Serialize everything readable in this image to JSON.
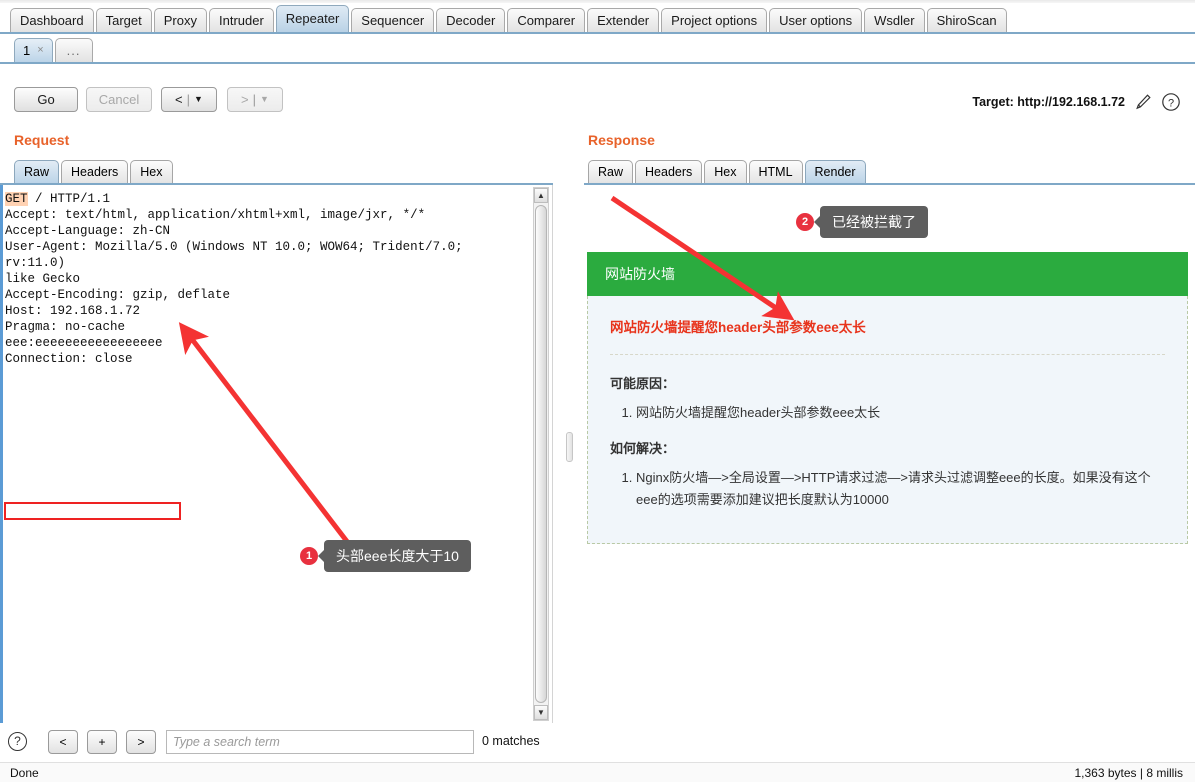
{
  "main_tabs": [
    {
      "label": "Dashboard",
      "active": false
    },
    {
      "label": "Target",
      "active": false
    },
    {
      "label": "Proxy",
      "active": false
    },
    {
      "label": "Intruder",
      "active": false
    },
    {
      "label": "Repeater",
      "active": true
    },
    {
      "label": "Sequencer",
      "active": false
    },
    {
      "label": "Decoder",
      "active": false
    },
    {
      "label": "Comparer",
      "active": false
    },
    {
      "label": "Extender",
      "active": false
    },
    {
      "label": "Project options",
      "active": false
    },
    {
      "label": "User options",
      "active": false
    },
    {
      "label": "Wsdler",
      "active": false
    },
    {
      "label": "ShiroScan",
      "active": false
    }
  ],
  "repeater_tabs": [
    {
      "label": "1",
      "close": "×",
      "active": true
    },
    {
      "label": "...",
      "active": false
    }
  ],
  "toolbar": {
    "go_label": "Go",
    "cancel_label": "Cancel",
    "back_glyph": "<",
    "back_caret": "▼",
    "forward_glyph": ">",
    "forward_caret": "▼",
    "separator": "|",
    "target_label": "Target: http://192.168.1.72",
    "edit_icon_name": "pencil-icon",
    "help_icon_name": "help-icon"
  },
  "request": {
    "title": "Request",
    "tabs": [
      {
        "label": "Raw",
        "active": true
      },
      {
        "label": "Headers",
        "active": false
      },
      {
        "label": "Hex",
        "active": false
      }
    ],
    "verb": "GET",
    "request_line_rest": " / HTTP/1.1",
    "body": "Accept: text/html, application/xhtml+xml, image/jxr, */*\nAccept-Language: zh-CN\nUser-Agent: Mozilla/5.0 (Windows NT 10.0; WOW64; Trident/7.0; rv:11.0)\nlike Gecko\nAccept-Encoding: gzip, deflate\nHost: 192.168.1.72\nPragma: no-cache\neee:eeeeeeeeeeeeeeeee\nConnection: close\n",
    "highlighted_header": "eee:eeeeeeeeeeeeeeeee"
  },
  "response": {
    "title": "Response",
    "tabs": [
      {
        "label": "Raw",
        "active": false
      },
      {
        "label": "Headers",
        "active": false
      },
      {
        "label": "Hex",
        "active": false
      },
      {
        "label": "HTML",
        "active": false
      },
      {
        "label": "Render",
        "active": true
      }
    ],
    "render": {
      "header_title": "网站防火墙",
      "alert": "网站防火墙提醒您header头部参数eee太长",
      "cause_heading": "可能原因：",
      "cause_items": [
        "网站防火墙提醒您header头部参数eee太长"
      ],
      "solution_heading": "如何解决：",
      "solution_items": [
        "Nginx防火墙—>全局设置—>HTTP请求过滤—>请求头过滤调整eee的长度。如果没有这个eee的选项需要添加建议把长度默认为10000"
      ],
      "header_bg": "#2bab3f",
      "body_bg": "#f1f6fa",
      "alert_color": "#e8341c"
    }
  },
  "annotations": [
    {
      "number": "1",
      "text": "头部eee长度大于10",
      "color": "#e8313f"
    },
    {
      "number": "2",
      "text": "已经被拦截了",
      "color": "#e8313f"
    }
  ],
  "search_bar": {
    "help_glyph": "?",
    "prev_label": "<",
    "plus_label": "+",
    "next_label": ">",
    "placeholder": "Type a search term",
    "value": "",
    "matches_label": "0 matches"
  },
  "status_bar": {
    "left": "Done",
    "right": "1,363 bytes | 8 millis"
  }
}
